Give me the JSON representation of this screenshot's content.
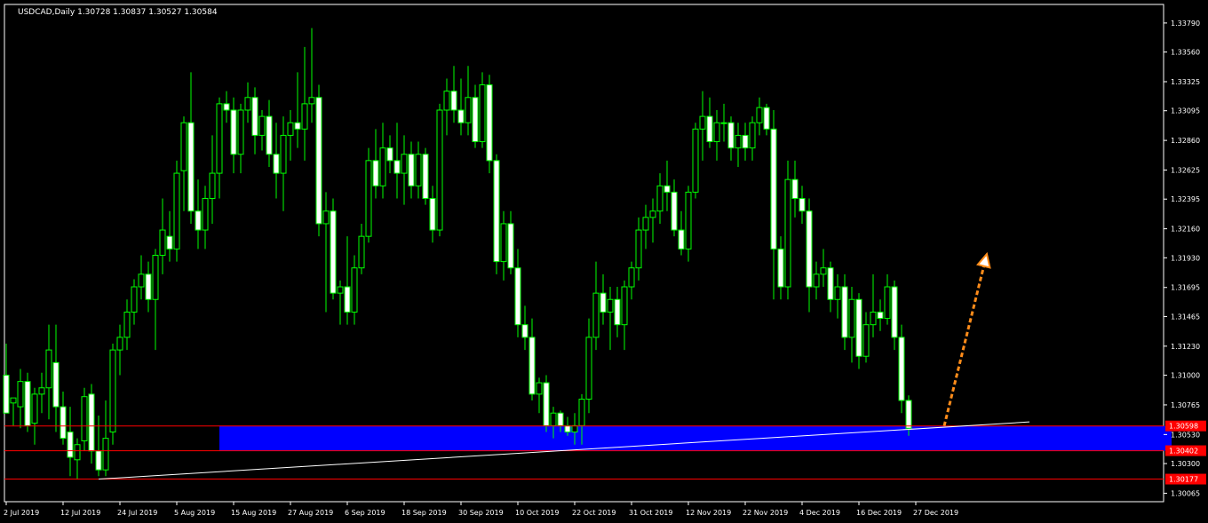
{
  "header": {
    "title": "USDCAD,Daily  1.30728 1.30837 1.30527 1.30584"
  },
  "colors": {
    "background": "#000000",
    "bull": "#000000",
    "bear": "#ffffff",
    "wick": "#00ff00",
    "axis": "#ffffff",
    "zone": "#0000ff",
    "level_line": "#ff0000",
    "trendline": "#ffffff",
    "arrow": "#ff8c1a"
  },
  "chart_data": {
    "type": "candlestick",
    "symbol": "USDCAD",
    "timeframe": "Daily",
    "ylim": [
      1.29998,
      1.33937
    ],
    "y_ticks": [
      "1.33790",
      "1.33560",
      "1.33325",
      "1.33095",
      "1.32860",
      "1.32625",
      "1.32395",
      "1.32160",
      "1.31930",
      "1.31695",
      "1.31465",
      "1.31230",
      "1.31000",
      "1.30765",
      "1.30530",
      "1.30300",
      "1.30065"
    ],
    "x_labels": [
      "2 Jul 2019",
      "12 Jul 2019",
      "24 Jul 2019",
      "5 Aug 2019",
      "15 Aug 2019",
      "27 Aug 2019",
      "6 Sep 2019",
      "18 Sep 2019",
      "30 Sep 2019",
      "10 Oct 2019",
      "22 Oct 2019",
      "31 Oct 2019",
      "12 Nov 2019",
      "22 Nov 2019",
      "4 Dec 2019",
      "16 Dec 2019",
      "27 Dec 2019"
    ],
    "x_label_index": [
      0,
      8,
      16,
      24,
      32,
      40,
      48,
      56,
      64,
      72,
      80,
      88,
      96,
      104,
      112,
      120,
      128
    ],
    "levels": [
      {
        "value": 1.30598,
        "label": "1.30598"
      },
      {
        "value": 1.30402,
        "label": "1.30402"
      },
      {
        "value": 1.30177,
        "label": "1.30177"
      }
    ],
    "zone": {
      "from_index": 30,
      "to_index": 164,
      "top": 1.30598,
      "bottom": 1.30402
    },
    "trendline": {
      "from": [
        13,
        1.30177
      ],
      "to": [
        144,
        1.3063
      ]
    },
    "arrow": {
      "from": [
        132,
        1.30598
      ],
      "to": [
        138,
        1.3196
      ]
    },
    "candles": [
      [
        1.31,
        1.3125,
        1.3075,
        1.307
      ],
      [
        1.3078,
        1.3082,
        1.306,
        1.3082
      ],
      [
        1.3075,
        1.3105,
        1.3058,
        1.3095
      ],
      [
        1.3095,
        1.3102,
        1.3055,
        1.306
      ],
      [
        1.3062,
        1.309,
        1.3045,
        1.3085
      ],
      [
        1.3085,
        1.3102,
        1.307,
        1.309
      ],
      [
        1.309,
        1.314,
        1.3065,
        1.312
      ],
      [
        1.311,
        1.314,
        1.3055,
        1.3075
      ],
      [
        1.3075,
        1.3087,
        1.3045,
        1.305
      ],
      [
        1.3055,
        1.3075,
        1.302,
        1.3035
      ],
      [
        1.3033,
        1.305,
        1.3018,
        1.3045
      ],
      [
        1.3048,
        1.309,
        1.304,
        1.3083
      ],
      [
        1.3085,
        1.3093,
        1.303,
        1.304
      ],
      [
        1.304,
        1.3068,
        1.302,
        1.3025
      ],
      [
        1.3025,
        1.308,
        1.302,
        1.305
      ],
      [
        1.3055,
        1.3125,
        1.3045,
        1.312
      ],
      [
        1.312,
        1.314,
        1.31,
        1.313
      ],
      [
        1.313,
        1.316,
        1.312,
        1.315
      ],
      [
        1.315,
        1.3176,
        1.314,
        1.317
      ],
      [
        1.317,
        1.3195,
        1.316,
        1.318
      ],
      [
        1.318,
        1.319,
        1.315,
        1.316
      ],
      [
        1.316,
        1.32,
        1.312,
        1.3195
      ],
      [
        1.3195,
        1.324,
        1.318,
        1.3215
      ],
      [
        1.321,
        1.323,
        1.319,
        1.32
      ],
      [
        1.32,
        1.327,
        1.319,
        1.326
      ],
      [
        1.3262,
        1.3305,
        1.323,
        1.33
      ],
      [
        1.33,
        1.334,
        1.322,
        1.323
      ],
      [
        1.323,
        1.3255,
        1.32,
        1.3215
      ],
      [
        1.3215,
        1.325,
        1.32,
        1.324
      ],
      [
        1.324,
        1.329,
        1.322,
        1.326
      ],
      [
        1.326,
        1.332,
        1.324,
        1.3315
      ],
      [
        1.3315,
        1.3325,
        1.33,
        1.331
      ],
      [
        1.331,
        1.332,
        1.326,
        1.3275
      ],
      [
        1.3275,
        1.3315,
        1.326,
        1.331
      ],
      [
        1.331,
        1.3332,
        1.33,
        1.332
      ],
      [
        1.332,
        1.3328,
        1.3275,
        1.329
      ],
      [
        1.329,
        1.331,
        1.3278,
        1.3305
      ],
      [
        1.3305,
        1.3318,
        1.3265,
        1.3275
      ],
      [
        1.3275,
        1.33,
        1.324,
        1.326
      ],
      [
        1.326,
        1.3305,
        1.323,
        1.329
      ],
      [
        1.329,
        1.331,
        1.327,
        1.33
      ],
      [
        1.33,
        1.334,
        1.328,
        1.3295
      ],
      [
        1.3295,
        1.336,
        1.327,
        1.3315
      ],
      [
        1.3315,
        1.3375,
        1.33,
        1.332
      ],
      [
        1.332,
        1.333,
        1.321,
        1.322
      ],
      [
        1.322,
        1.3245,
        1.315,
        1.323
      ],
      [
        1.323,
        1.324,
        1.316,
        1.3165
      ],
      [
        1.3165,
        1.3175,
        1.314,
        1.317
      ],
      [
        1.317,
        1.321,
        1.314,
        1.315
      ],
      [
        1.315,
        1.3195,
        1.314,
        1.3185
      ],
      [
        1.3185,
        1.322,
        1.318,
        1.321
      ],
      [
        1.321,
        1.328,
        1.3205,
        1.327
      ],
      [
        1.327,
        1.3295,
        1.324,
        1.325
      ],
      [
        1.325,
        1.33,
        1.324,
        1.328
      ],
      [
        1.328,
        1.329,
        1.326,
        1.327
      ],
      [
        1.327,
        1.33,
        1.324,
        1.326
      ],
      [
        1.326,
        1.329,
        1.3235,
        1.3275
      ],
      [
        1.3275,
        1.3285,
        1.324,
        1.325
      ],
      [
        1.325,
        1.3285,
        1.324,
        1.3275
      ],
      [
        1.3275,
        1.328,
        1.3235,
        1.324
      ],
      [
        1.324,
        1.325,
        1.3205,
        1.3215
      ],
      [
        1.3215,
        1.3315,
        1.321,
        1.331
      ],
      [
        1.331,
        1.3335,
        1.329,
        1.3325
      ],
      [
        1.3325,
        1.3345,
        1.33,
        1.331
      ],
      [
        1.331,
        1.3335,
        1.329,
        1.33
      ],
      [
        1.33,
        1.3345,
        1.329,
        1.332
      ],
      [
        1.332,
        1.333,
        1.328,
        1.3285
      ],
      [
        1.3285,
        1.334,
        1.328,
        1.333
      ],
      [
        1.333,
        1.3338,
        1.326,
        1.327
      ],
      [
        1.327,
        1.3275,
        1.318,
        1.319
      ],
      [
        1.319,
        1.323,
        1.3175,
        1.322
      ],
      [
        1.322,
        1.323,
        1.318,
        1.3185
      ],
      [
        1.3185,
        1.32,
        1.313,
        1.314
      ],
      [
        1.314,
        1.3155,
        1.312,
        1.313
      ],
      [
        1.313,
        1.3145,
        1.308,
        1.3085
      ],
      [
        1.3085,
        1.3098,
        1.307,
        1.3094
      ],
      [
        1.3094,
        1.31,
        1.3055,
        1.306
      ],
      [
        1.306,
        1.3075,
        1.305,
        1.307
      ],
      [
        1.307,
        1.3072,
        1.3055,
        1.306
      ],
      [
        1.306,
        1.3067,
        1.3052,
        1.3055
      ],
      [
        1.3055,
        1.307,
        1.3045,
        1.306
      ],
      [
        1.306,
        1.3085,
        1.3045,
        1.3081
      ],
      [
        1.3081,
        1.3145,
        1.307,
        1.313
      ],
      [
        1.313,
        1.319,
        1.312,
        1.3165
      ],
      [
        1.3165,
        1.318,
        1.314,
        1.315
      ],
      [
        1.315,
        1.317,
        1.312,
        1.316
      ],
      [
        1.316,
        1.317,
        1.313,
        1.314
      ],
      [
        1.314,
        1.3175,
        1.312,
        1.317
      ],
      [
        1.317,
        1.319,
        1.316,
        1.3185
      ],
      [
        1.3185,
        1.3225,
        1.3175,
        1.3215
      ],
      [
        1.3215,
        1.3235,
        1.32,
        1.3225
      ],
      [
        1.3225,
        1.324,
        1.3205,
        1.323
      ],
      [
        1.323,
        1.326,
        1.322,
        1.325
      ],
      [
        1.325,
        1.327,
        1.323,
        1.3245
      ],
      [
        1.3245,
        1.3255,
        1.321,
        1.3215
      ],
      [
        1.3215,
        1.323,
        1.3195,
        1.32
      ],
      [
        1.32,
        1.325,
        1.319,
        1.3245
      ],
      [
        1.3245,
        1.33,
        1.324,
        1.3295
      ],
      [
        1.3295,
        1.3325,
        1.327,
        1.3305
      ],
      [
        1.3305,
        1.332,
        1.328,
        1.3285
      ],
      [
        1.3285,
        1.331,
        1.327,
        1.33
      ],
      [
        1.33,
        1.3315,
        1.3285,
        1.33
      ],
      [
        1.33,
        1.3305,
        1.327,
        1.328
      ],
      [
        1.328,
        1.33,
        1.3265,
        1.329
      ],
      [
        1.329,
        1.33,
        1.327,
        1.328
      ],
      [
        1.328,
        1.3305,
        1.327,
        1.33
      ],
      [
        1.33,
        1.332,
        1.329,
        1.3312
      ],
      [
        1.3312,
        1.3315,
        1.329,
        1.3295
      ],
      [
        1.3295,
        1.331,
        1.316,
        1.32
      ],
      [
        1.32,
        1.321,
        1.316,
        1.317
      ],
      [
        1.317,
        1.327,
        1.316,
        1.3255
      ],
      [
        1.3255,
        1.327,
        1.3225,
        1.324
      ],
      [
        1.324,
        1.325,
        1.322,
        1.323
      ],
      [
        1.323,
        1.324,
        1.315,
        1.317
      ],
      [
        1.317,
        1.319,
        1.316,
        1.318
      ],
      [
        1.318,
        1.32,
        1.317,
        1.3185
      ],
      [
        1.3185,
        1.319,
        1.315,
        1.316
      ],
      [
        1.316,
        1.318,
        1.3145,
        1.317
      ],
      [
        1.317,
        1.318,
        1.312,
        1.313
      ],
      [
        1.313,
        1.317,
        1.311,
        1.316
      ],
      [
        1.316,
        1.3165,
        1.3105,
        1.3115
      ],
      [
        1.3115,
        1.315,
        1.311,
        1.314
      ],
      [
        1.314,
        1.318,
        1.313,
        1.315
      ],
      [
        1.315,
        1.316,
        1.3135,
        1.3145
      ],
      [
        1.3145,
        1.318,
        1.314,
        1.317
      ],
      [
        1.317,
        1.3175,
        1.312,
        1.313
      ],
      [
        1.313,
        1.314,
        1.307,
        1.308
      ],
      [
        1.308,
        1.3084,
        1.3052,
        1.3058
      ]
    ]
  }
}
